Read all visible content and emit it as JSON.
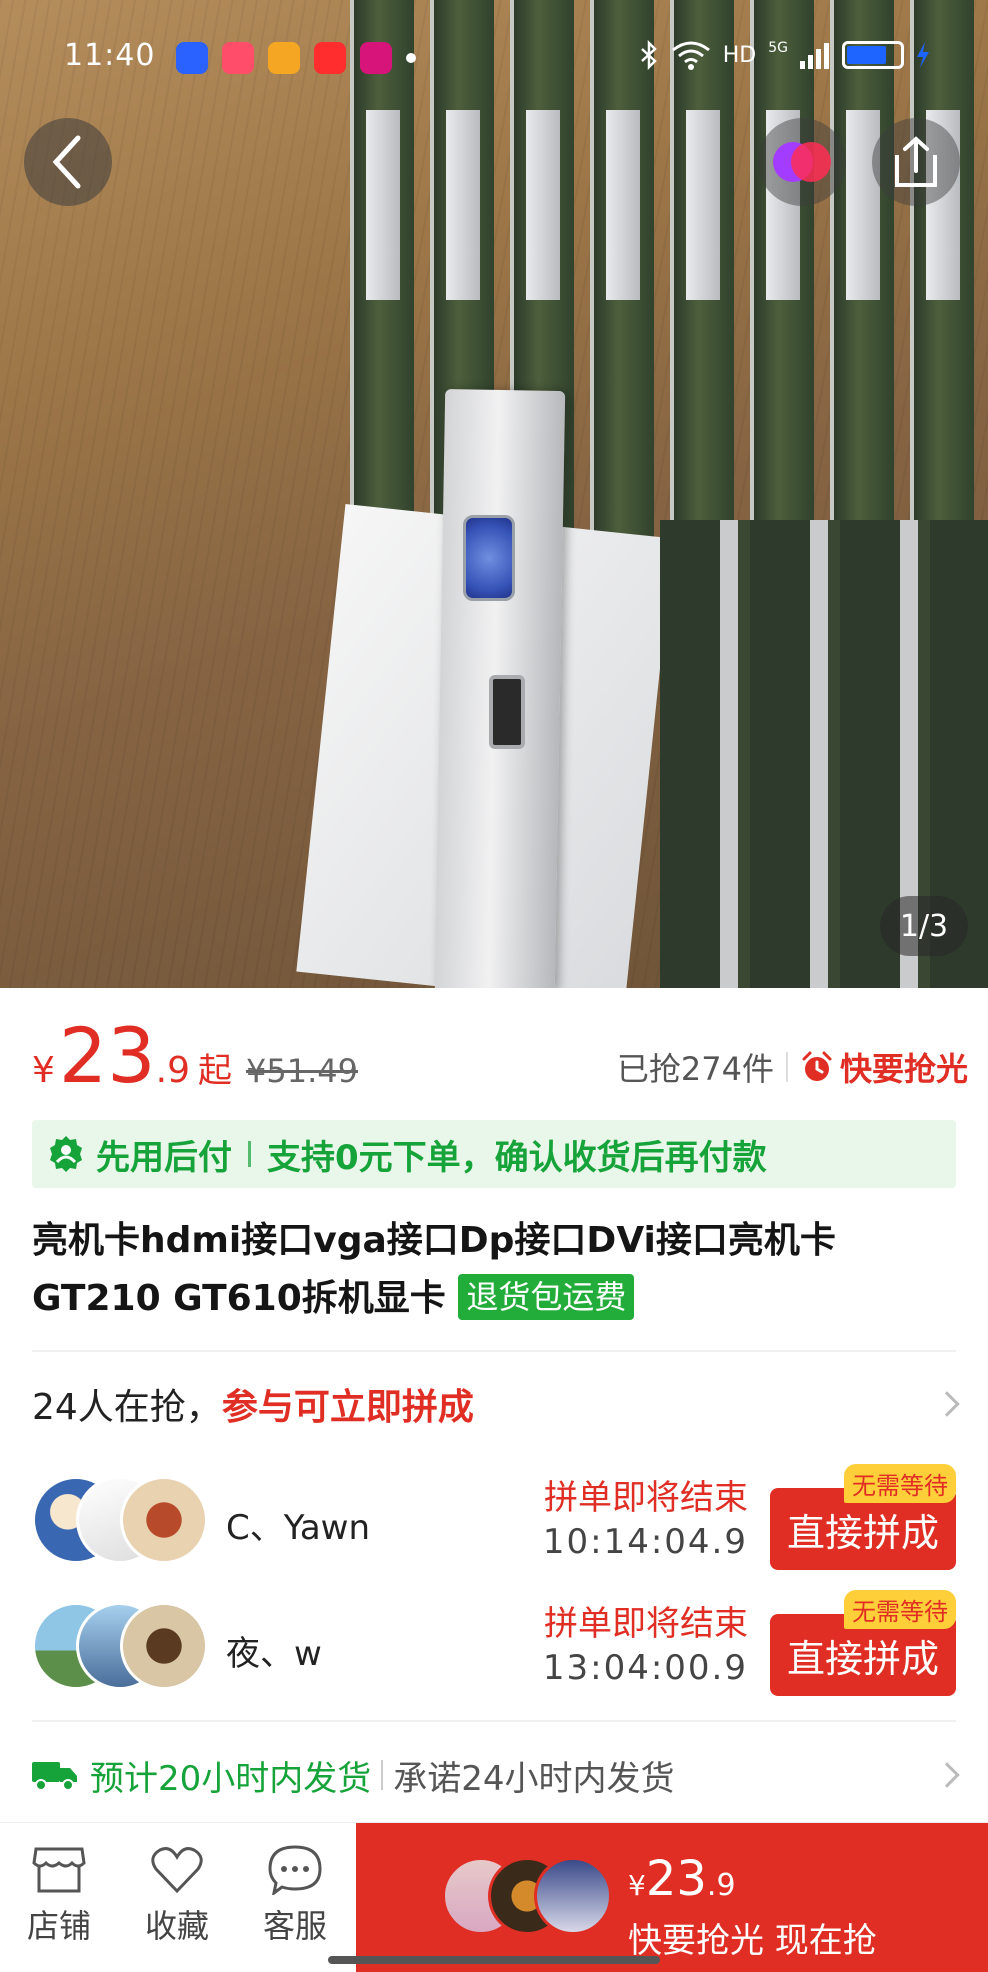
{
  "status_bar": {
    "time": "11:40",
    "network": "5G",
    "hd": "HD"
  },
  "hero": {
    "counter": "1/3"
  },
  "price": {
    "currency": "¥",
    "integer": "23",
    "decimal": ".9",
    "suffix": "起",
    "original": "¥51.49",
    "sold": "已抢274件",
    "hot": "快要抢光"
  },
  "paylater": {
    "main": "先用后付",
    "detail": "支持0元下单，确认收货后再付款"
  },
  "product": {
    "title": "亮机卡hdmi接口vga接口Dp接口DVi接口亮机卡GT210  GT610拆机显卡",
    "tag": "退货包运费"
  },
  "group_buy": {
    "count_text": "24人在抢，",
    "cta_text": "参与可立即拼成",
    "rows": [
      {
        "name": "C、Yawn",
        "status": "拼单即将结束",
        "timer": "10:14:04.9",
        "badge": "无需等待",
        "button": "直接拼成"
      },
      {
        "name": "夜、w",
        "status": "拼单即将结束",
        "timer": "13:04:00.9",
        "badge": "无需等待",
        "button": "直接拼成"
      }
    ]
  },
  "shipping": {
    "estimate": "预计20小时内发货",
    "promise": "承诺24小时内发货"
  },
  "bottom_bar": {
    "store": "店铺",
    "favorite": "收藏",
    "service": "客服",
    "buy_currency": "¥",
    "buy_integer": "23",
    "buy_decimal": ".9",
    "buy_label": "快要抢光 现在抢"
  },
  "colors": {
    "accent_red": "#e02e24",
    "green": "#16a33a",
    "badge_yellow": "#ffcf3a"
  }
}
